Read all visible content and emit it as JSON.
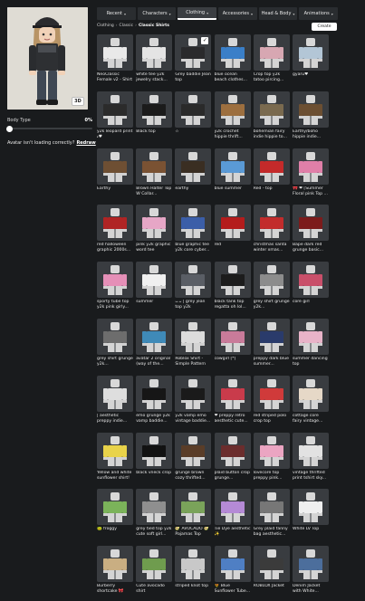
{
  "avatar": {
    "badge": "3D"
  },
  "body_type": {
    "label": "Body Type",
    "value_text": "0%",
    "value": 0
  },
  "avatar_help": {
    "text": "Avatar isn't loading correctly?",
    "link": "Redraw"
  },
  "tabs": [
    {
      "label": "Recent",
      "active": false
    },
    {
      "label": "Characters",
      "active": false
    },
    {
      "label": "Clothing",
      "active": true
    },
    {
      "label": "Accessories",
      "active": false
    },
    {
      "label": "Head & Body",
      "active": false
    },
    {
      "label": "Animations",
      "active": false
    }
  ],
  "breadcrumb": [
    "Clothing",
    "Classic",
    "Classic Shirts"
  ],
  "create_button": "Create",
  "items": [
    {
      "name": "NeoClassic Female v2 - Shirt",
      "color": "#e9e9e9",
      "equipped": false
    },
    {
      "name": "white tee y2k jewelry stack...",
      "color": "#e4e4e4",
      "equipped": false
    },
    {
      "name": "Grey baddie Jean top",
      "color": "#2a2a2c",
      "equipped": true
    },
    {
      "name": "blue ocean beach clothes...",
      "color": "#3a7fc8",
      "equipped": false
    },
    {
      "name": "Crop top y2k tatoo pircing...",
      "color": "#d7a7b2",
      "equipped": false
    },
    {
      "name": "gyaru♥",
      "color": "#b3c6d6",
      "equipped": false
    },
    {
      "name": "y2k leopard print 𝓈♥",
      "color": "#2b2b2b",
      "equipped": false
    },
    {
      "name": "Black top",
      "color": "#1b1b1b",
      "equipped": false
    },
    {
      "name": "☆",
      "color": "#2a2a2a",
      "equipped": false
    },
    {
      "name": "y2k crochet hippie thrift...",
      "color": "#9d6f3f",
      "equipped": false
    },
    {
      "name": "bohemian fairy indie hippie to...",
      "color": "#7a6a4f",
      "equipped": false
    },
    {
      "name": "Earthy/boho hippie indie...",
      "color": "#6c4f32",
      "equipped": false
    },
    {
      "name": "Earthy",
      "color": "#6e4f33",
      "equipped": false
    },
    {
      "name": "Brown Halter Top W Collar...",
      "color": "#7a5233",
      "equipped": false
    },
    {
      "name": "earthy",
      "color": "#3a2e22",
      "equipped": false
    },
    {
      "name": "blue summer",
      "color": "#5a9ad6",
      "equipped": false
    },
    {
      "name": "Red - top",
      "color": "#c42a2a",
      "equipped": false
    },
    {
      "name": "🎀 ❤ [Summer Floral pink Top ...",
      "color": "#e07fa8",
      "equipped": false
    },
    {
      "name": "red halloween graphic 2000s...",
      "color": "#b02424",
      "equipped": false
    },
    {
      "name": "pink y2k graphic word tee",
      "color": "#e6a6c6",
      "equipped": false
    },
    {
      "name": "blue graphic tee y2k core cyber...",
      "color": "#3b5ea8",
      "equipped": false
    },
    {
      "name": "red",
      "color": "#b41c1c",
      "equipped": false
    },
    {
      "name": "christmas santa winter xmas...",
      "color": "#c22c2c",
      "equipped": false
    },
    {
      "name": "Bape dark red grunge basic...",
      "color": "#7c1b1b",
      "equipped": false
    },
    {
      "name": "sporty tube top y2k pink girly...",
      "color": "#e58fb7",
      "equipped": false
    },
    {
      "name": "summer",
      "color": "#f0f0f0",
      "equipped": false
    },
    {
      "name": "ᴗ.ᴗ | grey jean top y2k",
      "color": "#5a5e65",
      "equipped": false
    },
    {
      "name": "black tank top regatta oh lol...",
      "color": "#1c1c1c",
      "equipped": false
    },
    {
      "name": "grey shirt grunge y2k...",
      "color": "#8c8c8c",
      "equipped": false
    },
    {
      "name": "core girl",
      "color": "#c94f6a",
      "equipped": false
    },
    {
      "name": "grey shirt grunge y2k...",
      "color": "#6d6d6d",
      "equipped": false
    },
    {
      "name": "avatar 2 original (way of the...",
      "color": "#3f8ab8",
      "equipped": false
    },
    {
      "name": "Roblox Shirt - Simple Pattern",
      "color": "#dcdcdc",
      "equipped": false
    },
    {
      "name": "cowgirl [*]",
      "color": "#c97b9a",
      "equipped": false
    },
    {
      "name": "preppy dark blue summer...",
      "color": "#2a3b6b",
      "equipped": false
    },
    {
      "name": "summer dancing top",
      "color": "#e8b3c8",
      "equipped": false
    },
    {
      "name": "| aesthetic preppy indie...",
      "color": "#dedede",
      "equipped": false
    },
    {
      "name": "emo grunge y2k vamp baddie...",
      "color": "#161616",
      "equipped": false
    },
    {
      "name": "y2k vamp emo vintage baddie...",
      "color": "#1a1a1a",
      "equipped": false
    },
    {
      "name": "❤ preppy retro aesthetic cute...",
      "color": "#c93b4b",
      "equipped": false
    },
    {
      "name": "red striped polo crop top",
      "color": "#d03a3a",
      "equipped": false
    },
    {
      "name": "cottage core fairy vintage...",
      "color": "#e6d8c7",
      "equipped": false
    },
    {
      "name": "Yellow and white sunflower shirt!",
      "color": "#e9d34a",
      "equipped": false
    },
    {
      "name": "black vneck crop",
      "color": "#121212",
      "equipped": false
    },
    {
      "name": "grunge brown cozy thrifted...",
      "color": "#5a3d28",
      "equipped": false
    },
    {
      "name": "plaid button crop grunge...",
      "color": "#6b2d2d",
      "equipped": false
    },
    {
      "name": "lovecore top preppy pink...",
      "color": "#eba5c2",
      "equipped": false
    },
    {
      "name": "vintage thrifted print tshirt sky...",
      "color": "#e2e2e2",
      "equipped": false
    },
    {
      "name": "🐸 froggy",
      "color": "#7bb35a",
      "equipped": false
    },
    {
      "name": "grey tied top y2k cute soft girl...",
      "color": "#8f8f8f",
      "equipped": false
    },
    {
      "name": "🥑 AVOCADO 🥑 Pajamas Top",
      "color": "#7aa35a",
      "equipped": false
    },
    {
      "name": "Tie Dye aesthetic ✨",
      "color": "#b58ad6",
      "equipped": false
    },
    {
      "name": "Grey plaid fanny bag aesthetic...",
      "color": "#777777",
      "equipped": false
    },
    {
      "name": "White LV Top",
      "color": "#efefef",
      "equipped": false
    },
    {
      "name": "Burberry shortcake 🎀",
      "color": "#c9ae82",
      "equipped": false
    },
    {
      "name": "Cute avocado shirt",
      "color": "#6f9c4e",
      "equipped": false
    },
    {
      "name": "striped knot top",
      "color": "#c8c8c8",
      "equipped": false
    },
    {
      "name": "🌻 Blue Sunflower Tube...",
      "color": "#4f7fc4",
      "equipped": false
    },
    {
      "name": "ROBLOX Jacket",
      "color": "#3b3b3b",
      "equipped": false
    },
    {
      "name": "Denim Jacket with White...",
      "color": "#4c6e9c",
      "equipped": false
    }
  ],
  "colors": {
    "background": "#191b1d",
    "tile": "#393c40",
    "tab": "#2a2d30"
  }
}
